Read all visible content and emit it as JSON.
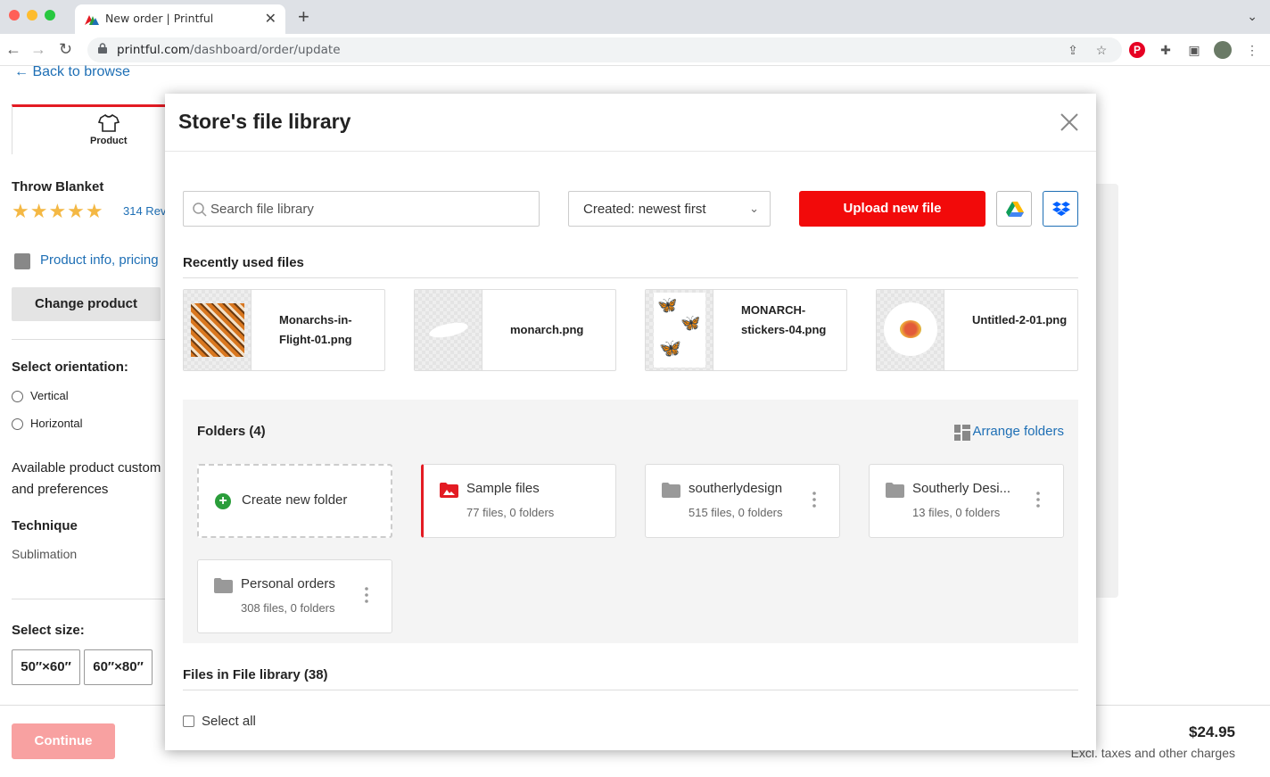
{
  "browser": {
    "tab_title": "New order | Printful",
    "url_host": "printful.com",
    "url_path": "/dashboard/order/update"
  },
  "page": {
    "back_link": "Back to browse",
    "product_tab_label": "Product",
    "product_name": "Throw Blanket",
    "rating_stars": 5,
    "reviews": "314 Rev",
    "product_info_link": "Product info, pricing",
    "change_product": "Change product",
    "orientation_label": "Select orientation:",
    "orientation_options": [
      "Vertical",
      "Horizontal"
    ],
    "available_text": "Available product custom and preferences",
    "technique_label": "Technique",
    "technique_value": "Sublimation",
    "size_label": "Select size:",
    "sizes": [
      "50″×60″",
      "60″×80″"
    ],
    "continue": "Continue",
    "price": "$24.95",
    "price_note": "Excl. taxes and other charges"
  },
  "modal": {
    "title": "Store's file library",
    "search_placeholder": "Search file library",
    "sort_label": "Created: newest first",
    "upload_button": "Upload new file",
    "recent_title": "Recently used files",
    "recent_files": [
      {
        "name": "Monarchs-in-Flight-01.png"
      },
      {
        "name": "monarch.png"
      },
      {
        "name": "MONARCH-stickers-04.png"
      },
      {
        "name": "Untitled-2-01.png"
      }
    ],
    "folders_title": "Folders (4)",
    "arrange_folders": "Arrange folders",
    "create_folder": "Create new folder",
    "folders": [
      {
        "name": "Sample files",
        "meta": "77 files, 0 folders",
        "active": true
      },
      {
        "name": "southerlydesign",
        "meta": "515 files, 0 folders"
      },
      {
        "name": "Southerly Desi...",
        "meta": "13 files, 0 folders"
      },
      {
        "name": "Personal orders",
        "meta": "308 files, 0 folders"
      }
    ],
    "files_title": "Files in File library (38)",
    "select_all": "Select all"
  },
  "colors": {
    "accent_red": "#f20a0a",
    "link_blue": "#1e6fb5"
  }
}
